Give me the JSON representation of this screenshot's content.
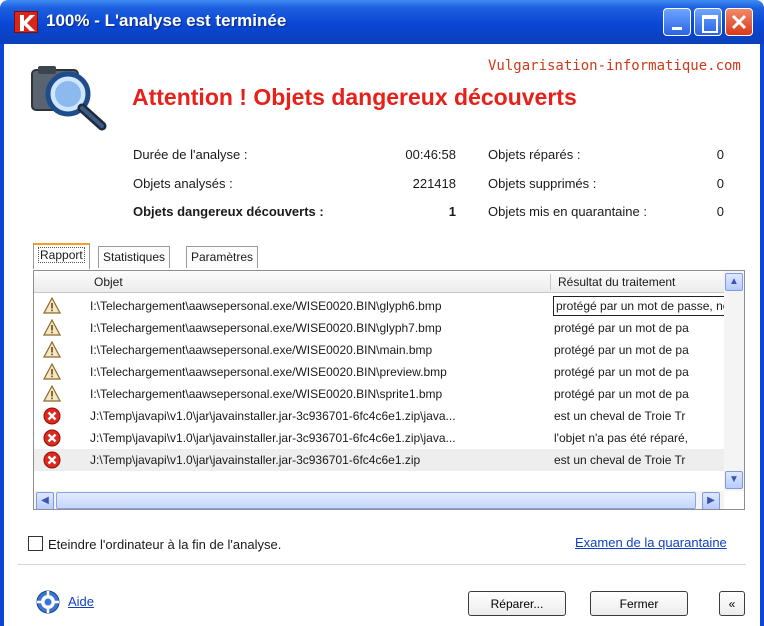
{
  "window": {
    "title": "100% - L'analyse est terminée"
  },
  "header": {
    "watermark": "Vulgarisation-informatique.com",
    "headline": "Attention ! Objets dangereux découverts"
  },
  "stats": {
    "left": [
      {
        "label": "Durée de l'analyse :",
        "value": "00:46:58"
      },
      {
        "label": "Objets analysés :",
        "value": "221418"
      },
      {
        "label": "Objets dangereux découverts :",
        "value": "1"
      }
    ],
    "right": [
      {
        "label": "Objets réparés :",
        "value": "0"
      },
      {
        "label": "Objets supprimés :",
        "value": "0"
      },
      {
        "label": "Objets mis en quarantaine :",
        "value": "0"
      }
    ]
  },
  "tabs": [
    {
      "label": "Rapport",
      "active": true
    },
    {
      "label": "Statistiques",
      "active": false
    },
    {
      "label": "Paramètres",
      "active": false
    }
  ],
  "report": {
    "columns": {
      "object": "Objet",
      "result": "Résultat du traitement"
    },
    "rows": [
      {
        "icon": "warning-icon",
        "object": "I:\\Telechargement\\aawsepersonal.exe/WISE0020.BIN\\glyph6.bmp",
        "result": "protégé par un mot de passe, non"
      },
      {
        "icon": "warning-icon",
        "object": "I:\\Telechargement\\aawsepersonal.exe/WISE0020.BIN\\glyph7.bmp",
        "result": "protégé par un mot de pa"
      },
      {
        "icon": "warning-icon",
        "object": "I:\\Telechargement\\aawsepersonal.exe/WISE0020.BIN\\main.bmp",
        "result": "protégé par un mot de pa"
      },
      {
        "icon": "warning-icon",
        "object": "I:\\Telechargement\\aawsepersonal.exe/WISE0020.BIN\\preview.bmp",
        "result": "protégé par un mot de pa"
      },
      {
        "icon": "warning-icon",
        "object": "I:\\Telechargement\\aawsepersonal.exe/WISE0020.BIN\\sprite1.bmp",
        "result": "protégé par un mot de pa"
      },
      {
        "icon": "danger-icon",
        "object": "J:\\Temp\\javapi\\v1.0\\jar\\javainstaller.jar-3c936701-6fc4c6e1.zip\\java...",
        "result": "est un cheval de Troie Tr"
      },
      {
        "icon": "danger-icon",
        "object": "J:\\Temp\\javapi\\v1.0\\jar\\javainstaller.jar-3c936701-6fc4c6e1.zip\\java...",
        "result": "l'objet n'a pas été réparé,"
      },
      {
        "icon": "danger-icon",
        "object": "J:\\Temp\\javapi\\v1.0\\jar\\javainstaller.jar-3c936701-6fc4c6e1.zip",
        "result": "est un cheval de Troie Tr"
      }
    ]
  },
  "footer": {
    "shutdown_checkbox": {
      "label": "Eteindre l'ordinateur à la fin de l'analyse.",
      "checked": false
    },
    "quarantine_link": "Examen de la quarantaine",
    "help_link": "Aide",
    "repair_button": "Réparer...",
    "close_button": "Fermer",
    "expand_button": "«"
  },
  "colors": {
    "titlebar": "#0a47d6",
    "headline": "#e8201a",
    "watermark": "#cc3a1a",
    "link": "#1040c8",
    "active_tab_accent": "#f0a030"
  }
}
